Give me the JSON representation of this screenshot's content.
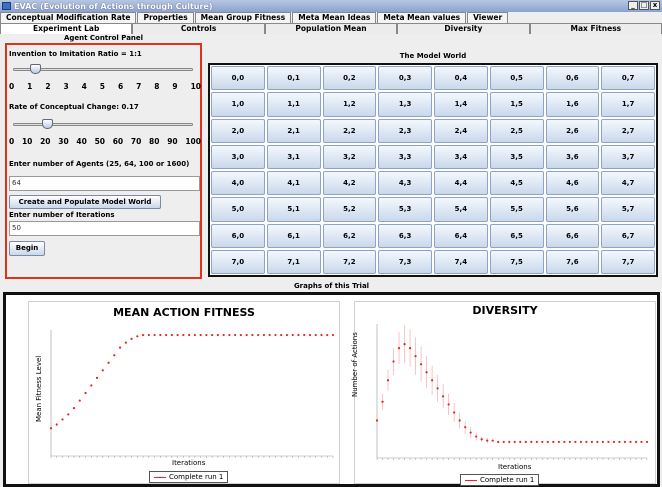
{
  "window": {
    "title": "EVAC (Evolution of Actions through Culture)"
  },
  "tabs_row1": [
    "Conceptual Modification Rate",
    "Properties",
    "Mean Group Fitness",
    "Meta Mean Ideas",
    "Meta Mean values",
    "Viewer"
  ],
  "tabs_row2": [
    "Experiment Lab",
    "Controls",
    "Population Mean",
    "Diversity",
    "Max Fitness"
  ],
  "control_panel": {
    "heading": "Agent Control Panel",
    "ratio_label": "Invention to Imitation Ratio = 1:1",
    "ratio_ticks": [
      "0",
      "1",
      "2",
      "3",
      "4",
      "5",
      "6",
      "7",
      "8",
      "9",
      "10"
    ],
    "ratio_value": 1,
    "ratio_max": 10,
    "change_label": "Rate of Conceptual Change: 0.17",
    "change_ticks": [
      "0",
      "10",
      "20",
      "30",
      "40",
      "50",
      "60",
      "70",
      "80",
      "90",
      "100"
    ],
    "change_value": 17,
    "change_max": 100,
    "agents_label": "Enter number of Agents (25, 64, 100 or 1600)",
    "agents_value": "64",
    "create_button": "Create and Populate Model World",
    "iterations_label": "Enter number of Iterations",
    "iterations_value": "50",
    "begin_button": "Begin"
  },
  "world": {
    "heading": "The Model World",
    "cells": [
      [
        "0,0",
        "0,1",
        "0,2",
        "0,3",
        "0,4",
        "0,5",
        "0,6",
        "0,7"
      ],
      [
        "1,0",
        "1,1",
        "1,2",
        "1,3",
        "1,4",
        "1,5",
        "1,6",
        "1,7"
      ],
      [
        "2,0",
        "2,1",
        "2,2",
        "2,3",
        "2,4",
        "2,5",
        "2,6",
        "2,7"
      ],
      [
        "3,0",
        "3,1",
        "3,2",
        "3,3",
        "3,4",
        "3,5",
        "3,6",
        "3,7"
      ],
      [
        "4,0",
        "4,1",
        "4,2",
        "4,3",
        "4,4",
        "4,5",
        "4,6",
        "4,7"
      ],
      [
        "5,0",
        "5,1",
        "5,2",
        "5,3",
        "5,4",
        "5,5",
        "5,6",
        "5,7"
      ],
      [
        "6,0",
        "6,1",
        "6,2",
        "6,3",
        "6,4",
        "6,5",
        "6,6",
        "6,7"
      ],
      [
        "7,0",
        "7,1",
        "7,2",
        "7,3",
        "7,4",
        "7,5",
        "7,6",
        "7,7"
      ]
    ]
  },
  "graphs_heading": "Graphs of this Trial",
  "chart_data": [
    {
      "type": "line",
      "title": "MEAN ACTION FITNESS",
      "xlabel": "Iterations",
      "ylabel": "Mean Fitness Level",
      "series": [
        {
          "name": "Complete run 1",
          "color": "#e22222",
          "values": [
            0.22,
            0.25,
            0.29,
            0.33,
            0.38,
            0.44,
            0.5,
            0.56,
            0.62,
            0.68,
            0.74,
            0.8,
            0.86,
            0.9,
            0.93,
            0.95,
            0.96,
            0.96,
            0.96,
            0.96,
            0.96,
            0.96,
            0.96,
            0.96,
            0.96,
            0.96,
            0.96,
            0.96,
            0.96,
            0.96,
            0.96,
            0.96,
            0.96,
            0.96,
            0.96,
            0.96,
            0.96,
            0.96,
            0.96,
            0.96,
            0.96,
            0.96,
            0.96,
            0.96,
            0.96,
            0.96,
            0.96,
            0.96,
            0.96,
            0.96
          ]
        }
      ],
      "ylim": [
        0,
        1
      ],
      "legend": "bottom-center"
    },
    {
      "type": "line",
      "title": "DIVERSITY",
      "xlabel": "Iterations",
      "ylabel": "Number of Actions",
      "series": [
        {
          "name": "Complete run 1",
          "color": "#e22222",
          "values": [
            0.28,
            0.42,
            0.58,
            0.72,
            0.82,
            0.85,
            0.82,
            0.76,
            0.7,
            0.64,
            0.58,
            0.52,
            0.46,
            0.4,
            0.34,
            0.28,
            0.23,
            0.19,
            0.16,
            0.14,
            0.13,
            0.13,
            0.12,
            0.12,
            0.12,
            0.12,
            0.12,
            0.12,
            0.12,
            0.12,
            0.12,
            0.12,
            0.12,
            0.12,
            0.12,
            0.12,
            0.12,
            0.12,
            0.12,
            0.12,
            0.12,
            0.12,
            0.12,
            0.12,
            0.12,
            0.12,
            0.12,
            0.12,
            0.12,
            0.12
          ],
          "error_band": [
            0.04,
            0.06,
            0.08,
            0.1,
            0.12,
            0.14,
            0.14,
            0.14,
            0.13,
            0.12,
            0.11,
            0.1,
            0.09,
            0.08,
            0.07,
            0.06,
            0.05,
            0.04,
            0.03,
            0.02,
            0.02,
            0.01,
            0.01,
            0.01,
            0.01,
            0.01,
            0.01,
            0.01,
            0.01,
            0.01,
            0.01,
            0.01,
            0.01,
            0.01,
            0.01,
            0.01,
            0.01,
            0.01,
            0.01,
            0.01,
            0.01,
            0.01,
            0.01,
            0.01,
            0.01,
            0.01,
            0.01,
            0.01,
            0.01,
            0.01
          ]
        }
      ],
      "ylim": [
        0,
        1
      ],
      "legend": "bottom-center"
    }
  ]
}
